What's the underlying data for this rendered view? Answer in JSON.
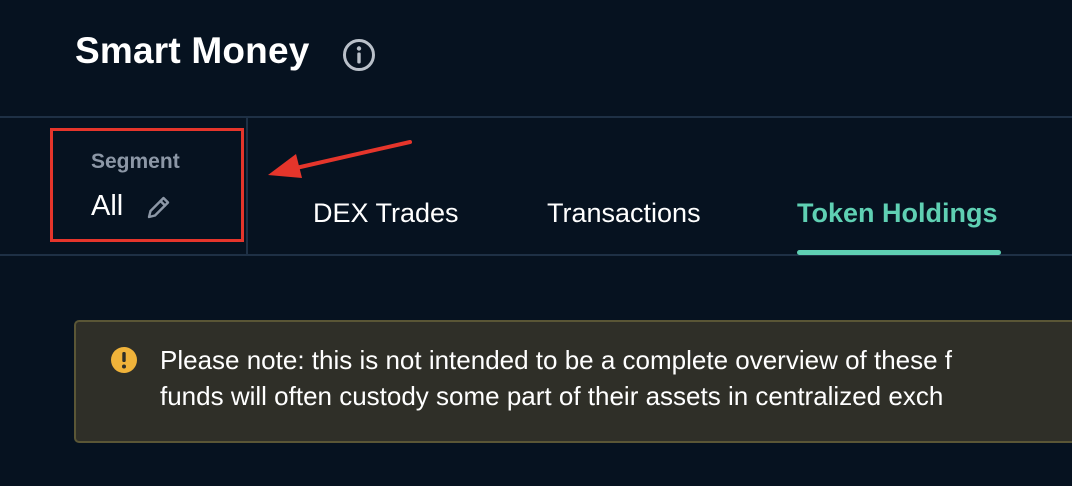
{
  "header": {
    "title": "Smart Money",
    "info_icon": "info-circle-icon"
  },
  "segment": {
    "label": "Segment",
    "value": "All",
    "edit_icon": "pencil-icon",
    "highlight_color": "#e5352b"
  },
  "annotation": {
    "arrow_icon": "arrow-left-icon",
    "color": "#e5352b"
  },
  "tabs": [
    {
      "label": "DEX Trades",
      "active": false
    },
    {
      "label": "Transactions",
      "active": false
    },
    {
      "label": "Token Holdings",
      "active": true
    }
  ],
  "notice": {
    "icon": "warning-icon",
    "line1": "Please note: this is not intended to be a complete overview of these f",
    "line2": "funds will often custody some part of their assets in centralized exch"
  },
  "colors": {
    "background": "#061220",
    "accent": "#5fd0b3",
    "warning": "#f0b33a",
    "notice_bg": "#2f2f28"
  }
}
